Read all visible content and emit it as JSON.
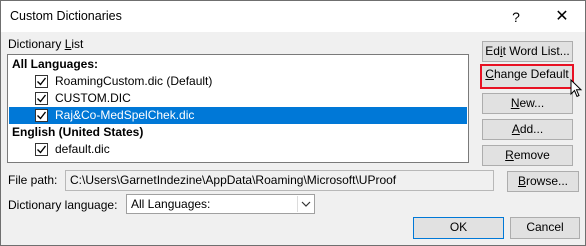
{
  "window": {
    "title": "Custom Dictionaries",
    "help_label": "?",
    "close_label": "✕"
  },
  "dictionary_list": {
    "label_pre": "Dictionary ",
    "label_ul": "L",
    "label_post": "ist",
    "groups": [
      {
        "heading": "All Languages:",
        "items": [
          {
            "name": "RoamingCustom.dic (Default)",
            "checked": true,
            "selected": false
          },
          {
            "name": "CUSTOM.DIC",
            "checked": true,
            "selected": false
          },
          {
            "name": "Raj&Co-MedSpelChek.dic",
            "checked": true,
            "selected": true
          }
        ]
      },
      {
        "heading": "English (United States)",
        "items": [
          {
            "name": "default.dic",
            "checked": true,
            "selected": false
          }
        ]
      }
    ]
  },
  "buttons": {
    "edit_word_list": {
      "pre": "Ed",
      "ul": "i",
      "post": "t Word List..."
    },
    "change_default": {
      "pre": "",
      "ul": "C",
      "post": "hange Default"
    },
    "new": {
      "pre": "",
      "ul": "N",
      "post": "ew..."
    },
    "add": {
      "pre": "",
      "ul": "A",
      "post": "dd..."
    },
    "remove": {
      "pre": "",
      "ul": "R",
      "post": "emove"
    },
    "browse": {
      "pre": "",
      "ul": "B",
      "post": "rowse..."
    },
    "ok": "OK",
    "cancel": "Cancel"
  },
  "file_path": {
    "label": "File path:",
    "value": "C:\\Users\\GarnetIndezine\\AppData\\Roaming\\Microsoft\\UProof"
  },
  "dictionary_language": {
    "label": "Dictionary language:",
    "selected": "All Languages:"
  },
  "colors": {
    "selection": "#0078d7",
    "focus_highlight": "#e81123"
  }
}
